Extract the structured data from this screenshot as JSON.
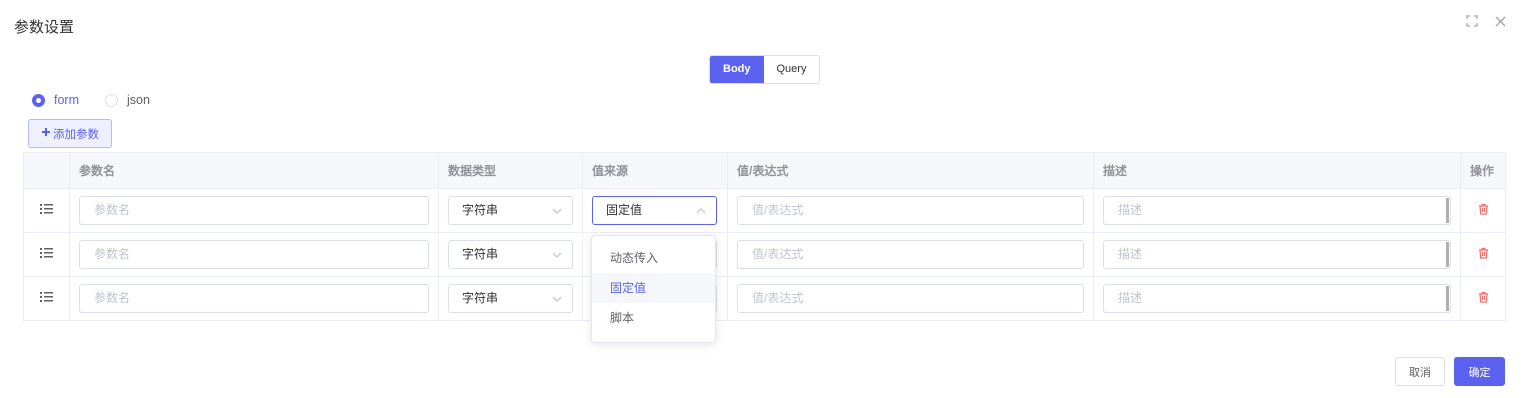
{
  "dialog": {
    "title": "参数设置"
  },
  "tabs": [
    {
      "label": "Body",
      "active": true
    },
    {
      "label": "Query",
      "active": false
    }
  ],
  "format_radios": [
    {
      "label": "form",
      "checked": true
    },
    {
      "label": "json",
      "checked": false
    }
  ],
  "add_param_label": "添加参数",
  "table": {
    "columns": [
      "参数名",
      "数据类型",
      "值来源",
      "值/表达式",
      "描述",
      "操作"
    ],
    "rows": [
      {
        "name_placeholder": "参数名",
        "data_type": "字符串",
        "value_source": "固定值",
        "value_placeholder": "值/表达式",
        "desc_placeholder": "描述"
      },
      {
        "name_placeholder": "参数名",
        "data_type": "字符串",
        "value_source": "",
        "value_placeholder": "值/表达式",
        "desc_placeholder": "描述"
      },
      {
        "name_placeholder": "参数名",
        "data_type": "字符串",
        "value_source": "",
        "value_placeholder": "值/表达式",
        "desc_placeholder": "描述"
      }
    ]
  },
  "value_source_dropdown": {
    "options": [
      "动态传入",
      "固定值",
      "脚本"
    ],
    "selected": "固定值"
  },
  "footer": {
    "cancel_label": "取消",
    "confirm_label": "确定"
  },
  "colors": {
    "primary": "#5b62f0",
    "danger": "#f56c6c"
  },
  "icons": [
    "fullscreen-icon",
    "close-icon",
    "plus-icon",
    "drag-handle-icon",
    "chevron-down-icon",
    "chevron-up-icon",
    "trash-icon"
  ]
}
